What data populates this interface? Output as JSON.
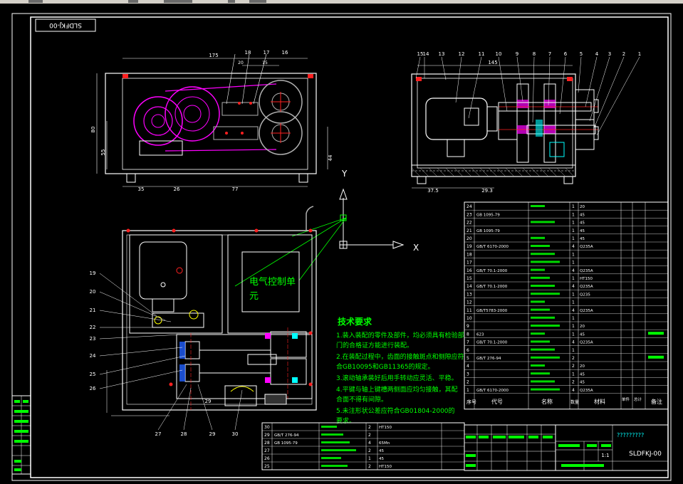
{
  "drawing": {
    "code_top": "SLDFKJ-00",
    "code_bottom": "SLDFKJ-00",
    "question_marks": "?????????",
    "scale": "1:1",
    "elec_label_line1": "电气控制单",
    "elec_label_line2": "元",
    "axis_y": "Y",
    "axis_x": "X"
  },
  "tech": {
    "title": "技术要求",
    "lines": [
      "1.装入装配的零件及部件，均必须具有检验部",
      "门的合格证方能进行装配。",
      "2.在装配过程中，齿面的接触斑点和侧隙应符",
      "合GB10095和GB11365的规定。",
      "3.滚动轴承装好后用手转动应灵活、平稳。",
      "4.平键与轴上键槽两侧面应均匀接触，其配",
      "合面不得有间隙。",
      "5.未注形状公差应符合GB01804-2000的",
      "要求。"
    ]
  },
  "dims": {
    "top_left": [
      "175",
      "35",
      "26",
      "77",
      "80",
      "55",
      "44",
      "20",
      "15"
    ],
    "top_right": [
      "145",
      "37.5",
      "29.3"
    ],
    "bottom": [
      "29"
    ]
  },
  "callouts": {
    "top_left": [
      "18",
      "17",
      "16"
    ],
    "top_right": [
      "15",
      "14",
      "13",
      "12",
      "11",
      "10",
      "9",
      "8",
      "7",
      "6",
      "5",
      "4",
      "3",
      "2",
      "1"
    ],
    "plan_left": [
      "19",
      "20",
      "21",
      "22",
      "23",
      "24",
      "25",
      "26"
    ],
    "plan_bottom": [
      "27",
      "28",
      "29",
      "30"
    ]
  },
  "bom": {
    "rows": [
      {
        "no": "24",
        "code": "",
        "name": "",
        "qty": "1",
        "mat": "20",
        "note": ""
      },
      {
        "no": "23",
        "code": "GB 1095-79",
        "name": "键",
        "qty": "1",
        "mat": "45",
        "note": ""
      },
      {
        "no": "22",
        "code": "",
        "name": "",
        "qty": "1",
        "mat": "45",
        "note": ""
      },
      {
        "no": "21",
        "code": "GB 1095-79",
        "name": "键",
        "qty": "1",
        "mat": "45",
        "note": ""
      },
      {
        "no": "20",
        "code": "",
        "name": "",
        "qty": "1",
        "mat": "45",
        "note": ""
      },
      {
        "no": "19",
        "code": "GB/T 6170-2000",
        "name": "",
        "qty": "4",
        "mat": "Q235A",
        "note": ""
      },
      {
        "no": "18",
        "code": "",
        "name": "",
        "qty": "1",
        "mat": "",
        "note": ""
      },
      {
        "no": "17",
        "code": "",
        "name": "",
        "qty": "1",
        "mat": "",
        "note": ""
      },
      {
        "no": "16",
        "code": "GB/T 70.1-2000",
        "name": "",
        "qty": "4",
        "mat": "Q235A",
        "note": ""
      },
      {
        "no": "15",
        "code": "",
        "name": "",
        "qty": "1",
        "mat": "HT150",
        "note": ""
      },
      {
        "no": "14",
        "code": "GB/T 70.1-2000",
        "name": "",
        "qty": "4",
        "mat": "Q235A",
        "note": ""
      },
      {
        "no": "13",
        "code": "",
        "name": "",
        "qty": "1",
        "mat": "Q235",
        "note": ""
      },
      {
        "no": "12",
        "code": "",
        "name": "",
        "qty": "1",
        "mat": "",
        "note": ""
      },
      {
        "no": "11",
        "code": "GB/T5783-2000",
        "name": "",
        "qty": "4",
        "mat": "Q235A",
        "note": ""
      },
      {
        "no": "10",
        "code": "",
        "name": "",
        "qty": "1",
        "mat": "",
        "note": ""
      },
      {
        "no": "9",
        "code": "",
        "name": "",
        "qty": "1",
        "mat": "20",
        "note": ""
      },
      {
        "no": "8",
        "code": "623",
        "name": "",
        "qty": "1",
        "mat": "45",
        "note": ""
      },
      {
        "no": "7",
        "code": "GB/T 70.1-2000",
        "name": "",
        "qty": "4",
        "mat": "Q235A",
        "note": ""
      },
      {
        "no": "6",
        "code": "",
        "name": "",
        "qty": "1",
        "mat": "",
        "note": ""
      },
      {
        "no": "5",
        "code": "GB/T 276-94",
        "name": "",
        "qty": "2",
        "mat": "",
        "note": ""
      },
      {
        "no": "4",
        "code": "",
        "name": "",
        "qty": "2",
        "mat": "20",
        "note": ""
      },
      {
        "no": "3",
        "code": "",
        "name": "",
        "qty": "1",
        "mat": "45",
        "note": ""
      },
      {
        "no": "2",
        "code": "",
        "name": "",
        "qty": "2",
        "mat": "45",
        "note": ""
      },
      {
        "no": "1",
        "code": "GB/T 6170-2000",
        "name": "",
        "qty": "4",
        "mat": "Q235A",
        "note": ""
      }
    ],
    "header": {
      "no": "序号",
      "code": "代号",
      "name": "名称",
      "qty": "数量",
      "mat": "材料",
      "unit": "单件",
      "total": "总计",
      "note": "备注"
    },
    "lower_rows": [
      {
        "no": "30",
        "code": "",
        "name": "",
        "qty": "2",
        "mat": "HT150"
      },
      {
        "no": "29",
        "code": "GB/T 276-94",
        "name": "",
        "qty": "2",
        "mat": ""
      },
      {
        "no": "28",
        "code": "GB 1095-79",
        "name": "",
        "qty": "4",
        "mat": "65Mn"
      },
      {
        "no": "27",
        "code": "",
        "name": "",
        "qty": "2",
        "mat": "45"
      },
      {
        "no": "26",
        "code": "",
        "name": "",
        "qty": "1",
        "mat": "45"
      },
      {
        "no": "25",
        "code": "",
        "name": "",
        "qty": "2",
        "mat": "HT150"
      }
    ]
  },
  "colors": {
    "green": "#00ff00",
    "white": "#ffffff",
    "magenta": "#ff00ff",
    "cyan": "#00ffff",
    "yellow": "#ffff00",
    "red": "#ff2020",
    "gray": "#9a9a9a",
    "blue": "#2060ff"
  }
}
